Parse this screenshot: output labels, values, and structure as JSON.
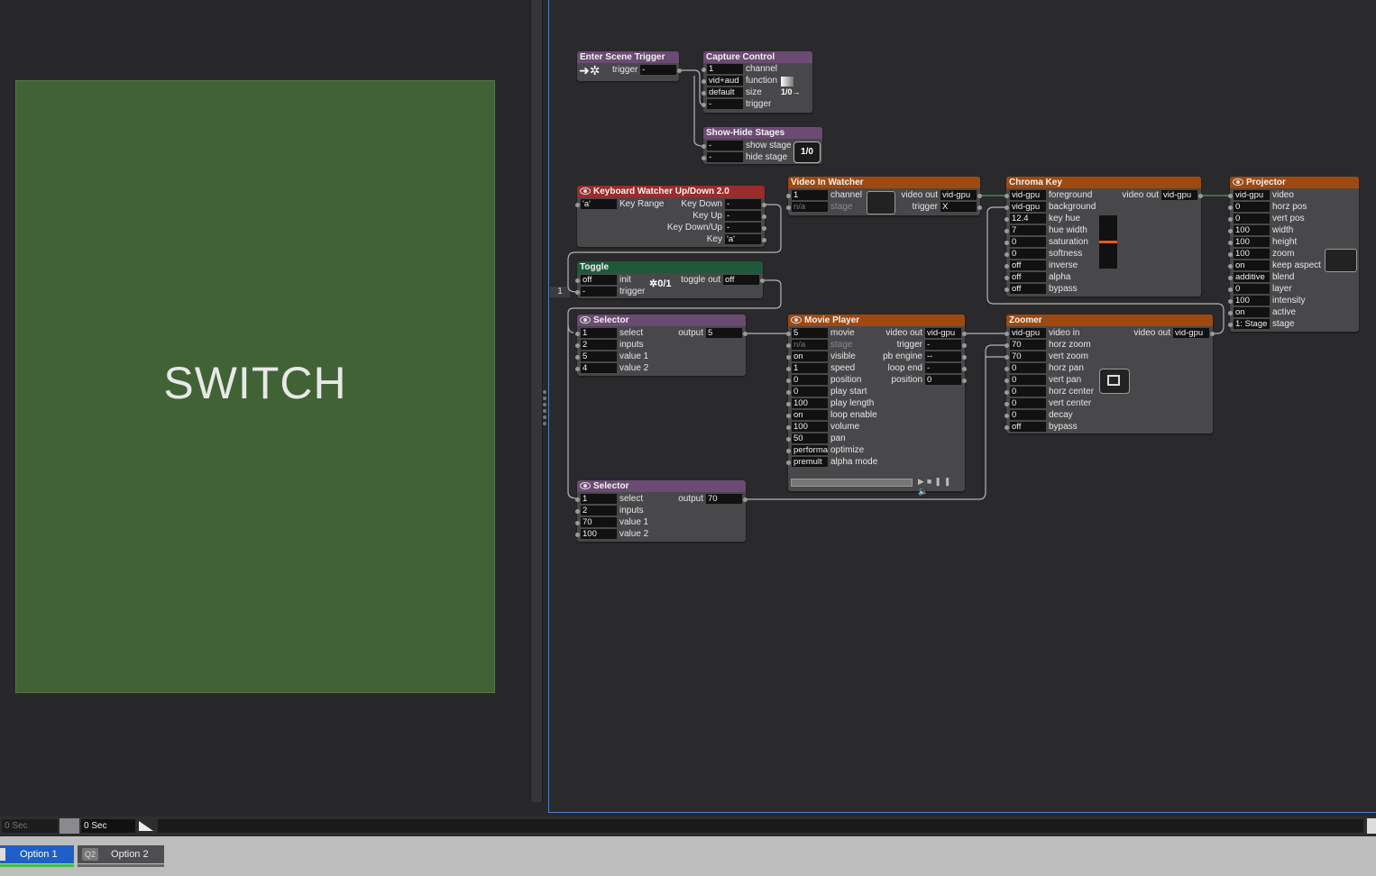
{
  "stage_preview": {
    "text": "SWITCH"
  },
  "patch_line_number": "1",
  "actors": {
    "enter_scene_trigger": {
      "title": "Enter Scene Trigger",
      "out_label": "trigger",
      "out_value": "-"
    },
    "capture_control": {
      "title": "Capture Control",
      "rows": [
        {
          "value": "1",
          "label": "channel"
        },
        {
          "value": "vid+aud",
          "label": "function"
        },
        {
          "value": "default",
          "label": "size"
        },
        {
          "value": "-",
          "label": "trigger"
        }
      ],
      "icon_text": "1/0→"
    },
    "show_hide_stages": {
      "title": "Show-Hide Stages",
      "rows": [
        {
          "value": "-",
          "label": "show stage"
        },
        {
          "value": "-",
          "label": "hide stage"
        }
      ],
      "icon_text": "1/0"
    },
    "keyboard_watcher": {
      "title": "Keyboard Watcher Up/Down 2.0",
      "in_value": "'a'",
      "in_label": "Key Range",
      "outputs": [
        {
          "label": "Key Down",
          "value": "-"
        },
        {
          "label": "Key Up",
          "value": "-"
        },
        {
          "label": "Key Down/Up",
          "value": "-"
        },
        {
          "label": "Key",
          "value": "'a'"
        }
      ]
    },
    "video_in_watcher": {
      "title": "Video In Watcher",
      "inputs": [
        {
          "value": "1",
          "label": "channel"
        },
        {
          "value": "n/a",
          "label": "stage"
        }
      ],
      "outputs": [
        {
          "label": "video out",
          "value": "vid-gpu"
        },
        {
          "label": "trigger",
          "value": "X"
        }
      ]
    },
    "chroma_key": {
      "title": "Chroma Key",
      "inputs": [
        {
          "value": "vid-gpu",
          "label": "foreground"
        },
        {
          "value": "vid-gpu",
          "label": "background"
        },
        {
          "value": "12.4",
          "label": "key hue"
        },
        {
          "value": "7",
          "label": "hue width"
        },
        {
          "value": "0",
          "label": "saturation"
        },
        {
          "value": "0",
          "label": "softness"
        },
        {
          "value": "off",
          "label": "inverse"
        },
        {
          "value": "off",
          "label": "alpha"
        },
        {
          "value": "off",
          "label": "bypass"
        }
      ],
      "output": {
        "label": "video out",
        "value": "vid-gpu"
      }
    },
    "projector": {
      "title": "Projector",
      "inputs": [
        {
          "value": "vid-gpu",
          "label": "video"
        },
        {
          "value": "0",
          "label": "horz pos"
        },
        {
          "value": "0",
          "label": "vert pos"
        },
        {
          "value": "100",
          "label": "width"
        },
        {
          "value": "100",
          "label": "height"
        },
        {
          "value": "100",
          "label": "zoom"
        },
        {
          "value": "on",
          "label": "keep aspect"
        },
        {
          "value": "additive",
          "label": "blend"
        },
        {
          "value": "0",
          "label": "layer"
        },
        {
          "value": "100",
          "label": "intensity"
        },
        {
          "value": "on",
          "label": "active"
        },
        {
          "value": "1: Stage",
          "label": "stage"
        }
      ]
    },
    "toggle": {
      "title": "Toggle",
      "inputs": [
        {
          "value": "off",
          "label": "init"
        },
        {
          "value": "-",
          "label": "trigger"
        }
      ],
      "output": {
        "label": "toggle out",
        "value": "off"
      },
      "icon_text": "0/1"
    },
    "selector_1": {
      "title": "Selector",
      "inputs": [
        {
          "value": "1",
          "label": "select"
        },
        {
          "value": "2",
          "label": "inputs"
        },
        {
          "value": "5",
          "label": "value 1"
        },
        {
          "value": "4",
          "label": "value 2"
        }
      ],
      "output": {
        "label": "output",
        "value": "5"
      }
    },
    "movie_player": {
      "title": "Movie Player",
      "inputs": [
        {
          "value": "5",
          "label": "movie"
        },
        {
          "value": "n/a",
          "label": "stage"
        },
        {
          "value": "on",
          "label": "visible"
        },
        {
          "value": "1",
          "label": "speed"
        },
        {
          "value": "0",
          "label": "position"
        },
        {
          "value": "0",
          "label": "play start"
        },
        {
          "value": "100",
          "label": "play length"
        },
        {
          "value": "on",
          "label": "loop enable"
        },
        {
          "value": "100",
          "label": "volume"
        },
        {
          "value": "50",
          "label": "pan"
        },
        {
          "value": "performance",
          "label": "optimize"
        },
        {
          "value": "premult",
          "label": "alpha mode"
        }
      ],
      "outputs": [
        {
          "label": "video out",
          "value": "vid-gpu"
        },
        {
          "label": "trigger",
          "value": "-"
        },
        {
          "label": "pb engine",
          "value": "--"
        },
        {
          "label": "loop end",
          "value": "-"
        },
        {
          "label": "position",
          "value": "0"
        }
      ]
    },
    "zoomer": {
      "title": "Zoomer",
      "inputs": [
        {
          "value": "vid-gpu",
          "label": "video in"
        },
        {
          "value": "70",
          "label": "horz zoom"
        },
        {
          "value": "70",
          "label": "vert zoom"
        },
        {
          "value": "0",
          "label": "horz pan"
        },
        {
          "value": "0",
          "label": "vert pan"
        },
        {
          "value": "0",
          "label": "horz center"
        },
        {
          "value": "0",
          "label": "vert center"
        },
        {
          "value": "0",
          "label": "decay"
        },
        {
          "value": "off",
          "label": "bypass"
        }
      ],
      "output": {
        "label": "video out",
        "value": "vid-gpu"
      }
    },
    "selector_2": {
      "title": "Selector",
      "inputs": [
        {
          "value": "1",
          "label": "select"
        },
        {
          "value": "2",
          "label": "inputs"
        },
        {
          "value": "70",
          "label": "value 1"
        },
        {
          "value": "100",
          "label": "value 2"
        }
      ],
      "output": {
        "label": "output",
        "value": "70"
      }
    }
  },
  "transport": {
    "time_a": "0 Sec",
    "time_b": "0 Sec"
  },
  "scenes": [
    {
      "number": "1",
      "name": "Option 1",
      "active": true
    },
    {
      "number": "Q2",
      "name": "Option 2",
      "active": false
    }
  ],
  "colors": {
    "stage_bg": "#416235",
    "active_scene": "#1f5fc7",
    "wire": "#b0b0b0",
    "wire_video": "#3fa24a"
  }
}
